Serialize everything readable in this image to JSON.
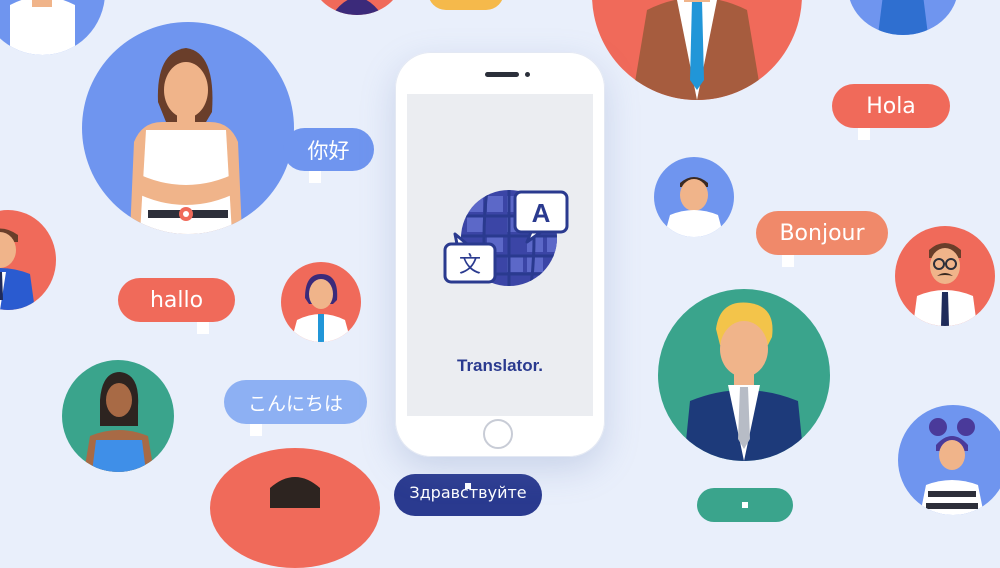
{
  "colors": {
    "background": "#e9effb",
    "blue": "#6f95ef",
    "coral": "#f06a5a",
    "teal": "#3aa48c",
    "navy": "#2a3a8f"
  },
  "app": {
    "name": "Translator.",
    "logo_icon": "translate-globe-icon",
    "logo_letters": {
      "latin": "A",
      "chinese": "文"
    }
  },
  "bubbles": {
    "nihao": "你好",
    "hola": "Hola",
    "bonjour": "Bonjour",
    "hallo": "hallo",
    "konnichiwa": "こんにちは",
    "zdravstvuyte": "Здравствуйте"
  }
}
